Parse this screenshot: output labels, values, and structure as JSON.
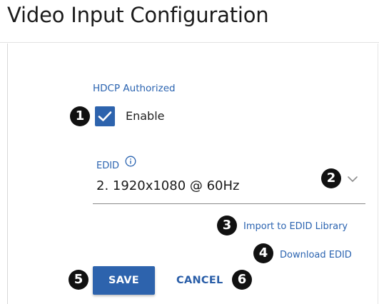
{
  "header": {
    "title": "Video Input Configuration"
  },
  "hdcp": {
    "section_label": "HDCP Authorized",
    "checkbox_label": "Enable",
    "checked": true
  },
  "edid": {
    "label": "EDID",
    "selected_value": "2. 1920x1080 @ 60Hz",
    "info_icon": "info-icon",
    "dropdown_icon": "chevron-down-icon"
  },
  "links": {
    "import": "Import to EDID Library",
    "download": "Download EDID"
  },
  "actions": {
    "save_label": "SAVE",
    "cancel_label": "CANCEL"
  },
  "callouts": [
    "1",
    "2",
    "3",
    "4",
    "5",
    "6"
  ],
  "colors": {
    "accent": "#2d63ad",
    "link": "#2a63b0",
    "callout": "#111111"
  }
}
